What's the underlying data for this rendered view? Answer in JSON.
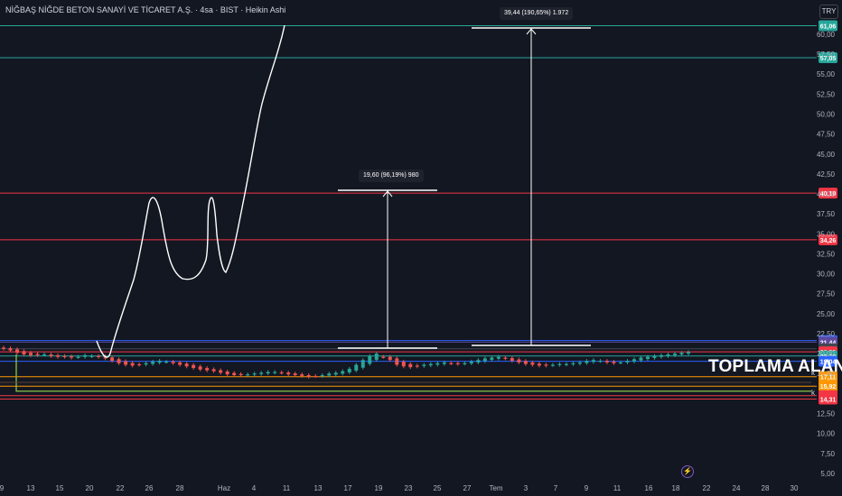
{
  "title": "NİĞBAŞ NİĞDE BETON SANAYİ VE TİCARET A.Ş. · 4sa · BIST · Heikin Ashi",
  "currency": "TRY",
  "overlay_label": "TOPLAMA ALANI",
  "measure_small": "19,60 (96,19%) 980",
  "measure_big": "39,44 (190,65%) 1.972",
  "k_marks": [
    "k",
    "k"
  ],
  "colors": {
    "background": "#131722",
    "up": "#26a69a",
    "down": "#ef5350",
    "grid": "#1e222d"
  },
  "chart_data": {
    "type": "candlestick",
    "style": "Heikin Ashi",
    "timeframe": "4sa",
    "x_tick_labels": [
      "9",
      "13",
      "15",
      "20",
      "22",
      "26",
      "28",
      "Haz",
      "4",
      "11",
      "13",
      "17",
      "19",
      "23",
      "25",
      "27",
      "Tem",
      "3",
      "7",
      "9",
      "11",
      "16",
      "18",
      "22",
      "24",
      "28",
      "30"
    ],
    "y_tick_labels": [
      "60,00",
      "57,50",
      "55,00",
      "52,50",
      "50,00",
      "47,50",
      "45,00",
      "42,50",
      "40,00",
      "37,50",
      "35,00",
      "32,50",
      "30,00",
      "27,50",
      "25,00",
      "22,50",
      "20,00",
      "17,50",
      "12,50",
      "10,00",
      "7,50",
      "5,00"
    ],
    "ylim": [
      4,
      62
    ],
    "price_lines": [
      {
        "label": "61,06",
        "value": 61.06,
        "color": "#26a69a"
      },
      {
        "label": "57,05",
        "value": 57.05,
        "color": "#26a69a"
      },
      {
        "label": "40,10",
        "value": 40.1,
        "color": "#f23645"
      },
      {
        "label": "34,26",
        "value": 34.26,
        "color": "#f23645"
      },
      {
        "label": "21,64",
        "value": 21.64,
        "color": "#2962ff"
      },
      {
        "label": "21,44",
        "value": 21.44,
        "color": "#5d4a9e"
      },
      {
        "label": "20,60",
        "value": 20.6,
        "color": "#434651"
      },
      {
        "label": "20,22",
        "value": 20.22,
        "color": "#f23645"
      },
      {
        "label": "20,22",
        "value": 19.7,
        "color": "#26a69a"
      },
      {
        "label": "19,04",
        "value": 19.04,
        "color": "#2962ff"
      },
      {
        "label": "17,11",
        "value": 17.11,
        "color": "#ff9800"
      },
      {
        "label": "15,92",
        "value": 15.92,
        "color": "#ff9800"
      },
      {
        "label": "14,73",
        "value": 14.73,
        "color": "#f23645"
      },
      {
        "label": "14,31",
        "value": 14.31,
        "color": "#f23645"
      }
    ],
    "series": [
      {
        "type": "heikin_ashi",
        "close": [
          20.6,
          20.4,
          20.1,
          19.9,
          19.8,
          19.8,
          19.9,
          19.7,
          19.6,
          19.6,
          19.5,
          19.6,
          19.8,
          19.7,
          19.6,
          19.4,
          19.1,
          18.8,
          18.6,
          18.5,
          18.6,
          18.8,
          19.0,
          19.1,
          19.0,
          18.8,
          18.6,
          18.4,
          18.2,
          18.0,
          17.9,
          17.8,
          17.6,
          17.4,
          17.3,
          17.3,
          17.4,
          17.5,
          17.6,
          17.7,
          17.7,
          17.6,
          17.4,
          17.3,
          17.2,
          17.1,
          17.2,
          17.3,
          17.5,
          17.6,
          17.8,
          18.1,
          18.6,
          19.2,
          19.7,
          20.0,
          19.6,
          19.2,
          18.6,
          18.4,
          18.3,
          18.4,
          18.6,
          18.7,
          18.8,
          18.9,
          18.8,
          18.7,
          18.8,
          19.0,
          19.2,
          19.4,
          19.5,
          19.6,
          19.4,
          19.1,
          18.9,
          18.7,
          18.6,
          18.5,
          18.5,
          18.6,
          18.7,
          18.7,
          18.8,
          18.9,
          19.1,
          19.2,
          19.1,
          18.9,
          18.8,
          18.9,
          19.1,
          19.3,
          19.5,
          19.6,
          19.7,
          19.8,
          19.9,
          20.0,
          20.1,
          20.2
        ]
      },
      {
        "type": "drawn_path",
        "name": ""
      }
    ]
  }
}
